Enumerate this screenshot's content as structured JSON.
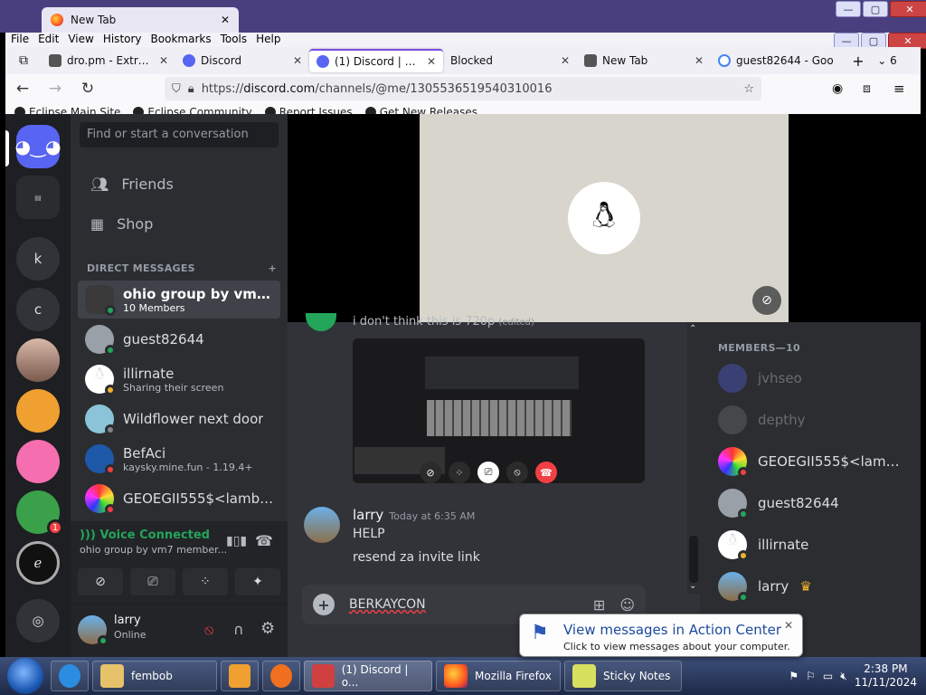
{
  "outer_window": {
    "tab_title": "New Tab",
    "controls": [
      "—",
      "▢",
      "✕"
    ]
  },
  "menu": [
    "File",
    "Edit",
    "View",
    "History",
    "Bookmarks",
    "Tools",
    "Help"
  ],
  "window_controls": [
    "—",
    "▢",
    "✕"
  ],
  "tabs": [
    {
      "label": "dro.pm - Extreme",
      "active": false
    },
    {
      "label": "Discord",
      "active": false
    },
    {
      "label": "(1) Discord | ohio",
      "active": true
    },
    {
      "label": "Blocked",
      "active": false
    },
    {
      "label": "New Tab",
      "active": false
    },
    {
      "label": "guest82644 - Goo",
      "active": false
    }
  ],
  "tab_count": "6",
  "url": {
    "scheme": "https://",
    "host": "discord.com",
    "path": "/channels/@me/1305536519540310016"
  },
  "bookmarks": [
    "Eclipse Main Site",
    "Eclipse Community",
    "Report Issues",
    "Get New Releases"
  ],
  "servers": [
    {
      "label": "k"
    },
    {
      "label": "c"
    }
  ],
  "server_badge": "1",
  "dm_sidebar": {
    "search_placeholder": "Find or start a conversation",
    "friends": "Friends",
    "shop": "Shop",
    "header": "DIRECT MESSAGES",
    "add": "+",
    "items": [
      {
        "name": "ohio group by vm7 me...",
        "sub": "10 Members"
      },
      {
        "name": "guest82644",
        "sub": ""
      },
      {
        "name": "illirnate",
        "sub": "Sharing their screen"
      },
      {
        "name": "Wildflower next door",
        "sub": ""
      },
      {
        "name": "BefAci",
        "sub": "kaysky.mine.fun - 1.19.4+"
      },
      {
        "name": "GEOEGII555$<lambd...",
        "sub": ""
      }
    ]
  },
  "voice": {
    "status": "Voice Connected",
    "channel": "ohio group by vm7 member..."
  },
  "user_panel": {
    "name": "larry",
    "status": "Online"
  },
  "chat": {
    "partial_message": "i don't think this is 720p",
    "edited": "(edited)",
    "message": {
      "author": "larry",
      "time": "Today at 6:35 AM",
      "lines": [
        "HELP",
        "resend za invite link"
      ]
    },
    "compose_text": "BERKAYCON"
  },
  "members": {
    "header": "MEMBERS—10",
    "list": [
      {
        "name": "jvhseo",
        "offline": true
      },
      {
        "name": "depthy",
        "offline": true
      },
      {
        "name": "GEOEGII555$<lambd...",
        "offline": false
      },
      {
        "name": "guest82644",
        "offline": false
      },
      {
        "name": "illirnate",
        "offline": false
      },
      {
        "name": "larry",
        "offline": false
      }
    ]
  },
  "notification": {
    "title": "View messages in Action Center",
    "subtitle": "Click to view messages about your computer."
  },
  "taskbar": {
    "items": [
      "fembob",
      "(1) Discord | o...",
      "Mozilla Firefox",
      "Sticky Notes"
    ],
    "time": "2:38 PM",
    "date": "11/11/2024"
  }
}
